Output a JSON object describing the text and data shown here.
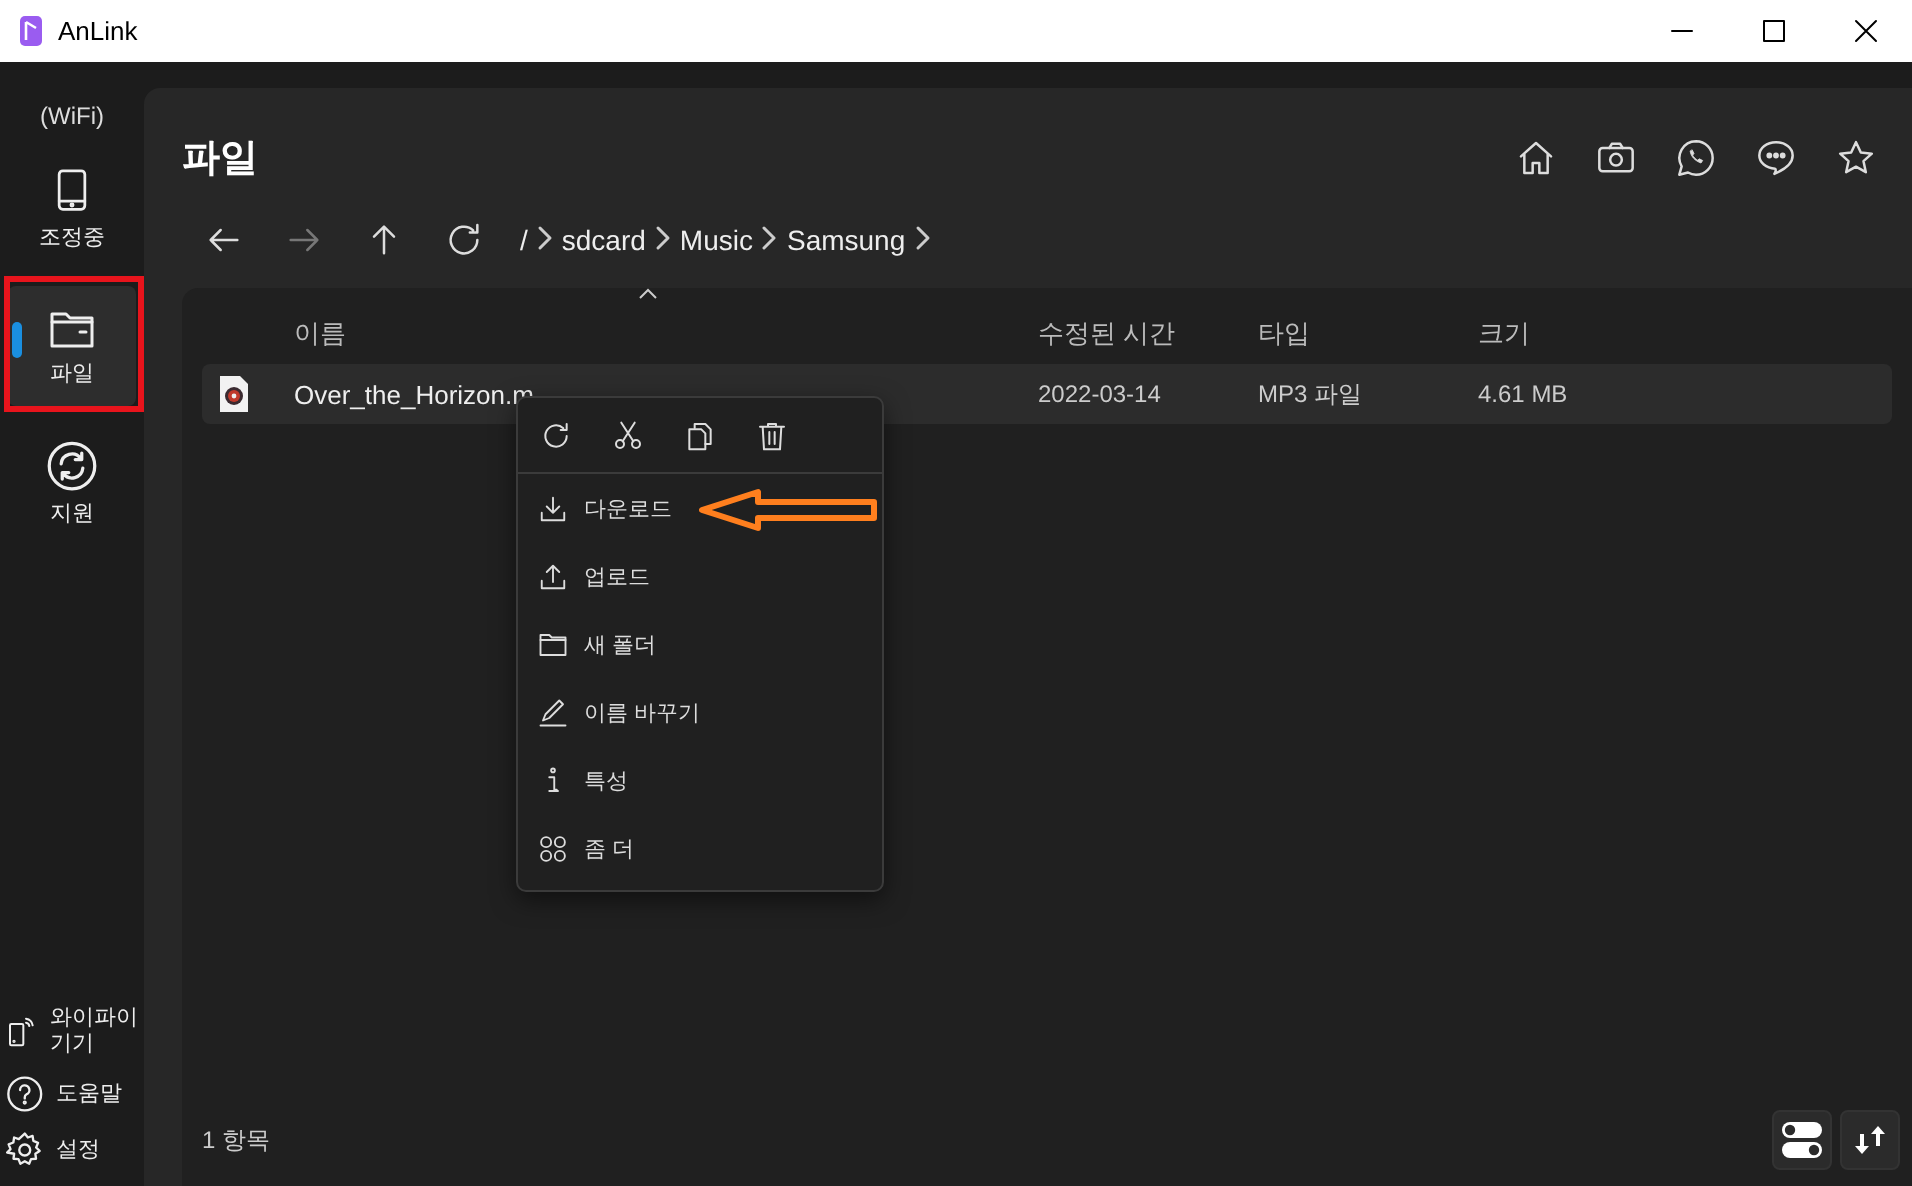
{
  "window": {
    "title": "AnLink"
  },
  "sidebar": {
    "connection": "(WiFi)",
    "items": [
      {
        "label": "조정중",
        "selected": false
      },
      {
        "label": "파일",
        "selected": true
      },
      {
        "label": "지원",
        "selected": false
      }
    ],
    "bottom_items": [
      {
        "label": "와이파이 기기"
      },
      {
        "label": "도움말"
      },
      {
        "label": "설정"
      }
    ]
  },
  "page": {
    "title": "파일",
    "breadcrumb": [
      "/",
      "sdcard",
      "Music",
      "Samsung"
    ]
  },
  "table": {
    "columns": [
      "이름",
      "수정된 시간",
      "타입",
      "크기"
    ],
    "rows": [
      {
        "name": "Over_the_Horizon.m",
        "modified": "2022-03-14",
        "type": "MP3 파일",
        "size": "4.61 MB",
        "selected": true
      }
    ]
  },
  "context_menu": {
    "items": [
      "다운로드",
      "업로드",
      "새 폴더",
      "이름 바꾸기",
      "특성",
      "좀 더"
    ]
  },
  "status_bar": {
    "count": "1 항목"
  }
}
